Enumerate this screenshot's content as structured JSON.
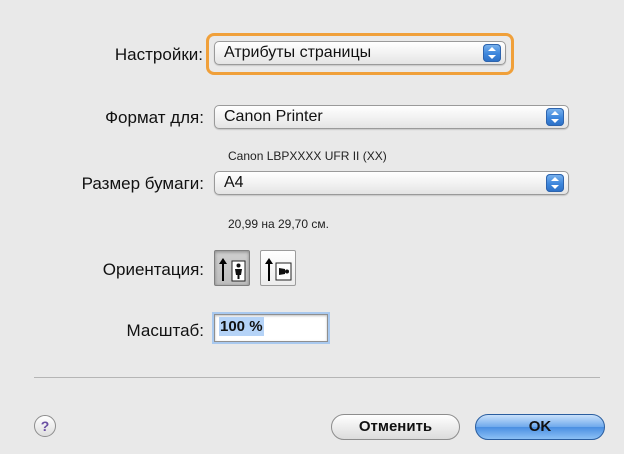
{
  "settings": {
    "label": "Настройки:",
    "value": "Атрибуты страницы"
  },
  "format_for": {
    "label": "Формат для:",
    "value": "Canon Printer",
    "sub": "Canon LBPXXXX UFR II (XX)"
  },
  "paper_size": {
    "label": "Размер бумаги:",
    "value": "A4",
    "sub": "20,99 на 29,70 см."
  },
  "orientation": {
    "label": "Ориентация:",
    "selected": "portrait"
  },
  "scale": {
    "label": "Масштаб:",
    "value": "100 %"
  },
  "buttons": {
    "help": "?",
    "cancel": "Отменить",
    "ok": "OK"
  },
  "colors": {
    "focus_ring": "#f0a03a",
    "popup_arrows": "#3d86dc",
    "default_button": "#4a8fe2"
  }
}
